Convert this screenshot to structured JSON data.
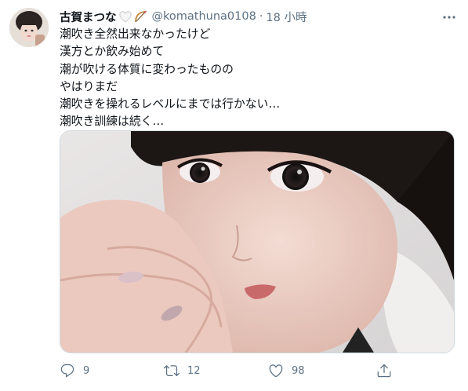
{
  "tweet": {
    "display_name": "古賀まつな",
    "handle": "@komathuna0108",
    "separator": "·",
    "time": "18 小時",
    "lines": [
      "潮吹き全然出来なかったけど",
      "漢方とか飲み始めて",
      "潮が吹ける体質に変わったものの",
      "やはりまだ",
      "潮吹きを操れるレベルにまでは行かない…",
      "潮吹き訓練は続く…"
    ]
  },
  "actions": {
    "reply_count": "9",
    "retweet_count": "12",
    "like_count": "98"
  },
  "icons": {
    "more": "more-horizontal-icon",
    "reply": "reply-icon",
    "retweet": "retweet-icon",
    "like": "heart-icon",
    "share": "share-icon",
    "emoji1": "white-heart-emoji-icon",
    "emoji2": "bow-and-arrow-emoji-icon"
  },
  "colors": {
    "text": "#0f1419",
    "secondary": "#5b7083",
    "border": "#cfd9de"
  }
}
